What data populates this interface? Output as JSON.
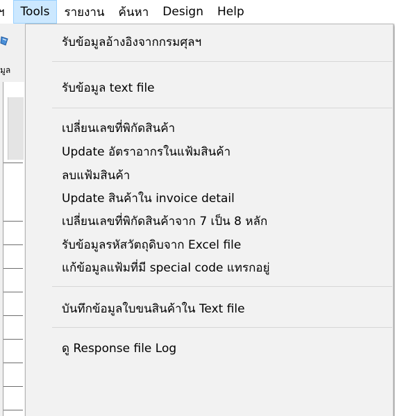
{
  "menubar": {
    "cut_left": "ฯ",
    "items": [
      {
        "label": "Tools",
        "active": true
      },
      {
        "label": "รายงาน"
      },
      {
        "label": "ค้นหา"
      },
      {
        "label": "Design"
      },
      {
        "label": "Help"
      }
    ]
  },
  "background_window": {
    "label_fragment": "มูล"
  },
  "tools_menu": {
    "items": [
      {
        "label": "รับข้อมูลอ้างอิงจากกรมศุลฯ"
      },
      {
        "label": "รับข้อมูล text file"
      },
      {
        "label": "เปลี่ยนเลขที่พิกัดสินค้า"
      },
      {
        "label": "Update อัตราอากรในแฟ้มสินค้า"
      },
      {
        "label": "ลบแฟ้มสินค้า"
      },
      {
        "label": "Update สินค้าใน invoice detail"
      },
      {
        "label": "เปลี่ยนเลขที่พิกัดสินค้าจาก 7 เป็น 8 หลัก"
      },
      {
        "label": "รับข้อมูลรหัสวัตถุดิบจาก Excel file"
      },
      {
        "label": "แก้ข้อมูลแฟ้มที่มี special code แทรกอยู่"
      },
      {
        "label": "บันทึกข้อมูลใบขนสินค้าใน Text file"
      },
      {
        "label": "ดู Response file Log"
      }
    ]
  },
  "colors": {
    "menu_active_bg": "#cce8ff",
    "menu_active_border": "#99d1ff",
    "dropdown_bg": "#f2f2f2",
    "separator": "#d7d7d7"
  }
}
